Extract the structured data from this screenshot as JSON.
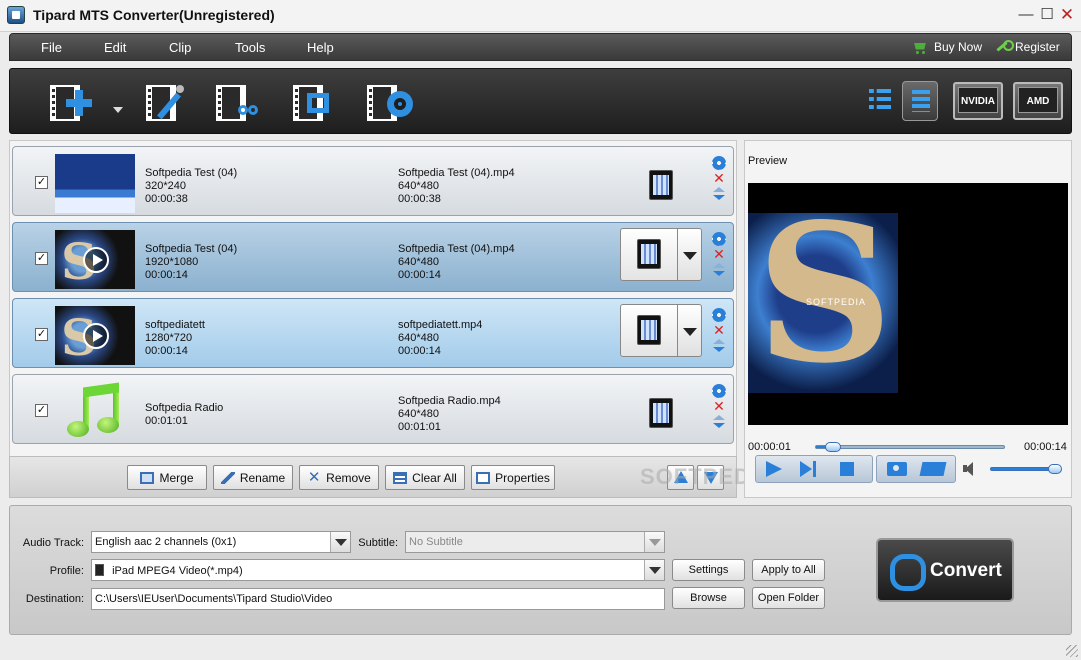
{
  "window": {
    "title": "Tipard MTS Converter(Unregistered)"
  },
  "menu": {
    "items": [
      "File",
      "Edit",
      "Clip",
      "Tools",
      "Help"
    ],
    "buy_now": "Buy Now",
    "register": "Register"
  },
  "toolbar": {
    "icons": [
      "add-video-icon",
      "edit-effect-icon",
      "clip-icon",
      "merge-crop-icon",
      "preferences-icon"
    ],
    "gpu": {
      "nvidia": "NVIDIA",
      "amd": "AMD"
    }
  },
  "files": [
    {
      "checked": true,
      "src_name": "Softpedia Test (04)",
      "src_res": "320*240",
      "src_dur": "00:00:38",
      "dst_name": "Softpedia Test (04).mp4",
      "dst_res": "640*480",
      "dst_dur": "00:00:38"
    },
    {
      "checked": true,
      "src_name": "Softpedia Test (04)",
      "src_res": "1920*1080",
      "src_dur": "00:00:14",
      "dst_name": "Softpedia Test (04).mp4",
      "dst_res": "640*480",
      "dst_dur": "00:00:14"
    },
    {
      "checked": true,
      "src_name": "softpediatett",
      "src_res": "1280*720",
      "src_dur": "00:00:14",
      "dst_name": "softpediatett.mp4",
      "dst_res": "640*480",
      "dst_dur": "00:00:14"
    },
    {
      "checked": true,
      "src_name": "Softpedia Radio",
      "src_dur": "00:01:01",
      "dst_name": "Softpedia Radio.mp4",
      "dst_res": "640*480",
      "dst_dur": "00:01:01"
    }
  ],
  "actions": {
    "merge": "Merge",
    "rename": "Rename",
    "remove": "Remove",
    "clear_all": "Clear All",
    "properties": "Properties"
  },
  "watermark": "SOFTPEDIA",
  "preview": {
    "label": "Preview",
    "image_caption": "SOFTPEDIA",
    "current_time": "00:00:01",
    "total_time": "00:00:14",
    "progress_fraction": 0.07,
    "volume_fraction": 0.95
  },
  "settings": {
    "audio_track_label": "Audio Track:",
    "audio_track_value": "English aac 2 channels (0x1)",
    "subtitle_label": "Subtitle:",
    "subtitle_value": "No Subtitle",
    "profile_label": "Profile:",
    "profile_value": "iPad MPEG4 Video(*.mp4)",
    "destination_label": "Destination:",
    "destination_value": "C:\\Users\\IEUser\\Documents\\Tipard Studio\\Video",
    "settings_btn": "Settings",
    "apply_all_btn": "Apply to All",
    "browse_btn": "Browse",
    "open_folder_btn": "Open Folder",
    "convert_btn": "Convert"
  },
  "colors": {
    "accent": "#2a7fd8",
    "toolbar_bg": "#1e1e1e",
    "selected_row": "#a2cbea"
  }
}
